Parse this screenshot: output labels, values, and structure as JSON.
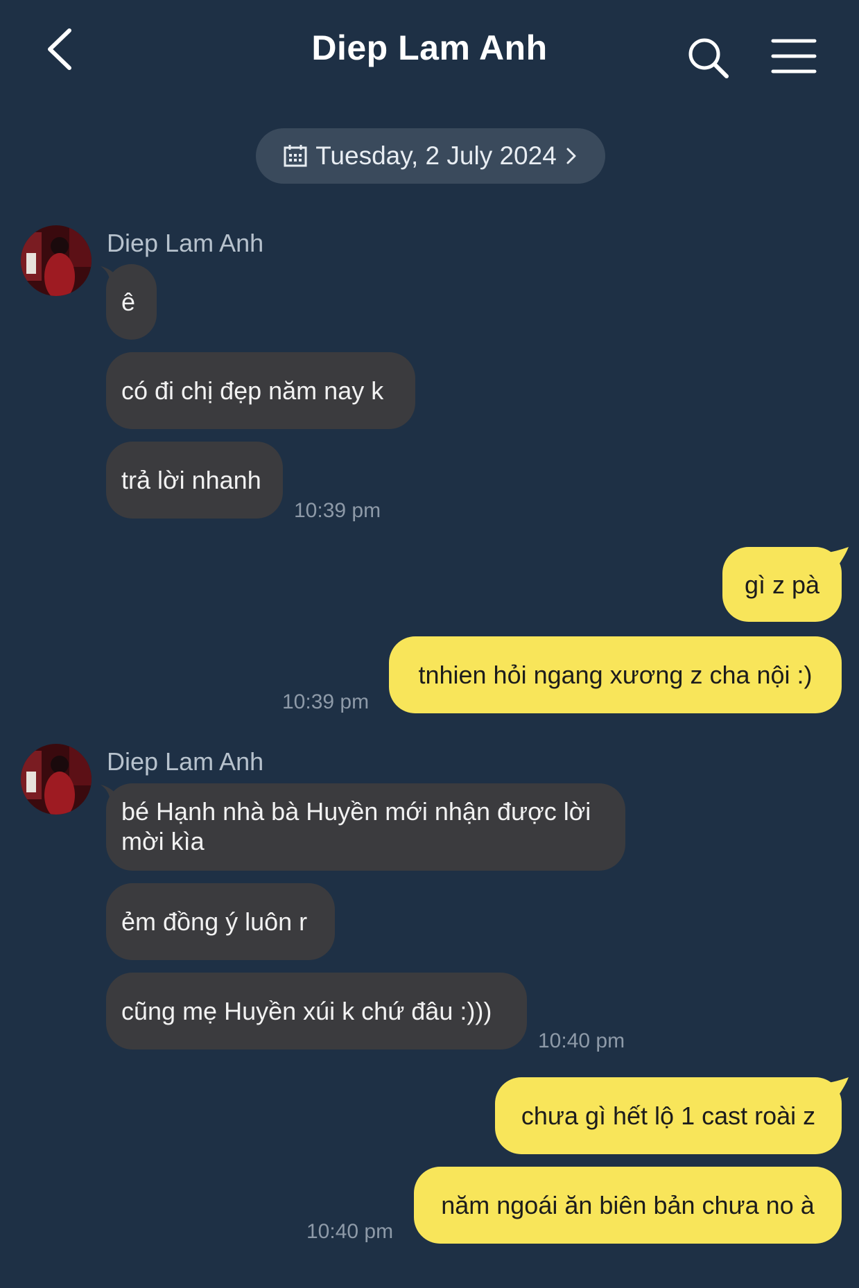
{
  "header": {
    "title": "Diep Lam Anh",
    "back_icon": "chevron-left-icon",
    "search_icon": "search-icon",
    "menu_icon": "menu-icon"
  },
  "date_separator": {
    "label": "Tuesday, 2 July 2024",
    "icon": "calendar-icon"
  },
  "colors": {
    "background": "#1e3045",
    "incoming_bubble": "#3b3b3e",
    "outgoing_bubble": "#f8e55a",
    "date_pill": "#3a4a5c"
  },
  "messages": {
    "group1": {
      "sender": "Diep Lam Anh",
      "items": [
        "ê",
        "có đi chị đẹp năm nay k",
        "trả lời nhanh"
      ],
      "time": "10:39 pm"
    },
    "group2": {
      "items": [
        "gì z pà",
        "tnhien hỏi ngang xương z cha nội :)"
      ],
      "time": "10:39 pm"
    },
    "group3": {
      "sender": "Diep Lam Anh",
      "items": [
        "bé Hạnh nhà bà Huyền mới nhận được lời mời kìa",
        "ẻm đồng ý luôn r",
        "cũng mẹ Huyền xúi k chứ đâu :)))"
      ],
      "time": "10:40 pm"
    },
    "group4": {
      "items": [
        "chưa gì hết lộ 1 cast roài z",
        "năm ngoái ăn biên bản chưa no à"
      ],
      "time": "10:40 pm"
    }
  }
}
